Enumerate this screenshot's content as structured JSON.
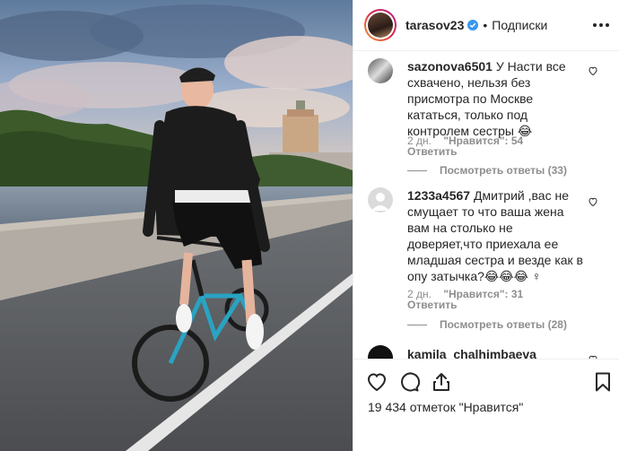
{
  "post": {
    "username": "tarasov23",
    "dot": "•",
    "follow_label": "Подписки",
    "likes_text": "19 434 отметок \"Нравится\""
  },
  "comments": [
    {
      "username": "sazonova6501",
      "text": "У Насти все схвачено, нельзя без присмотра по Москве кататься, только под контролем сестры 😂",
      "age": "2 дн.",
      "likes": "\"Нравится\": 54",
      "reply_label": "Ответить",
      "view_replies": "Посмотреть ответы (33)"
    },
    {
      "username": "1233a4567",
      "text": "Дмитрий ,вас не смущает то что ваша жена вам на столько не доверяет,что приехала ее младшая сестра и везде как в опу затычка?😂😂😂 ♀",
      "age": "2 дн.",
      "likes": "\"Нравится\": 31",
      "reply_label": "Ответить",
      "view_replies": "Посмотреть ответы (28)"
    },
    {
      "username": "kamila_chalhimbaeva",
      "text": ""
    }
  ],
  "icons": {
    "more": "more-options-icon",
    "like": "heart-icon",
    "comment": "comment-icon",
    "share": "share-icon",
    "save": "bookmark-icon",
    "verified": "verified-badge-icon"
  },
  "colors": {
    "verified": "#3897f0",
    "secondary_text": "#8e8e8e",
    "primary_text": "#262626"
  }
}
